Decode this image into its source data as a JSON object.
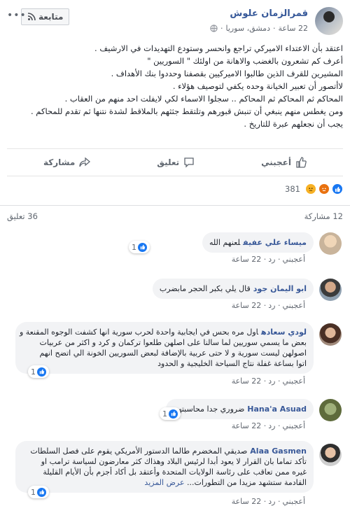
{
  "post": {
    "author": "قمرالزمان علوش",
    "time": "22 ساعة",
    "location": "دمشق، سوريا",
    "follow_label": "متابعة",
    "lines": [
      "اعتقد بأن الاعتداء الاميركي تراجع وانحسر وستودع التهديدات في الارشيف .",
      "أعرف كم تشعرون بالغضب والاهانة من اولئك \" السوريين \"",
      "المشيرين للقرف الذين طالبوا الاميركيين بقصفنا وحددوا بنك الأهداف .",
      "لاأتصور أن تعبير الخيانة وحده يكفي لتوصيف هؤلاء .",
      "المحاكم ثم المحاكم ثم المحاكم .. سجلوا الاسماء لكي لايفلت احد منهم من العقاب .",
      "ومن يغطس منهم ينبغي أن تنبش قبورهم وتلتقط جثثهم بالملاقط لشدة نتنها ثم تقدم للمحاكم .",
      "يجب أن نجعلهم عبرة للتاريخ ."
    ]
  },
  "actions": {
    "like": "أعجبني",
    "comment": "تعليق",
    "share": "مشاركة"
  },
  "reactions": {
    "count": "381"
  },
  "stats": {
    "shares": "12 مشاركة",
    "comments": "36 تعليق"
  },
  "comment_actions": {
    "like": "أعجبني",
    "reply": "رد",
    "time": "22 ساعة"
  },
  "comments": [
    {
      "name": "ميساء علي عفيف",
      "lines": [
        "لعنهم الله"
      ],
      "likes": "1"
    },
    {
      "name": "ابو اليمان جود",
      "lines": [
        "قال يلي بكبر الحجر مابضرب"
      ],
      "likes": ""
    },
    {
      "name": "لودي سعاده",
      "lines": [
        "اول مره بحس في ايجابية واحدة لحرب سورية انها كشفت الوجوه المقنعة و",
        "بعض ما يسمي سوريين لما سالنا على اصلهن طلعوا تركمان و كرد و اكثر من عربيات",
        "اصولهن ليست سورية و لا حتى عربية بالإضافة لبعض السوريين الخونة الي اتضح انهم",
        "اتوا بساعة غفلة نتاج السياحة الخليجية و الحدود"
      ],
      "likes": "1"
    },
    {
      "name": "Hana'a Asuad",
      "lines": [
        "ضروري جدا محاسبتهم"
      ],
      "likes": "1"
    },
    {
      "name": "Alaa Gasmen",
      "lines": [
        "صديقي المخضرم طالما الدستور الأمريكي يقوم على فصل السلطات",
        "تأكد تماما بان القرار لا يعود أبدا لرئيس البلاد وهذاك كثر معارضون لسياسة ترامب او",
        "غيره ممن تعاقب على رئاسة الولايات المتحدة وأعتقد بل أكاد أجزم بأن الأيام القليلة",
        "القادمة ستشهد مزيدا من التطورات..."
      ],
      "see_more": "عرض المزيد",
      "likes": "1"
    }
  ],
  "colors": {
    "link": "#385898",
    "like_blue": "#1877f2",
    "bubble": "#f2f3f5"
  }
}
